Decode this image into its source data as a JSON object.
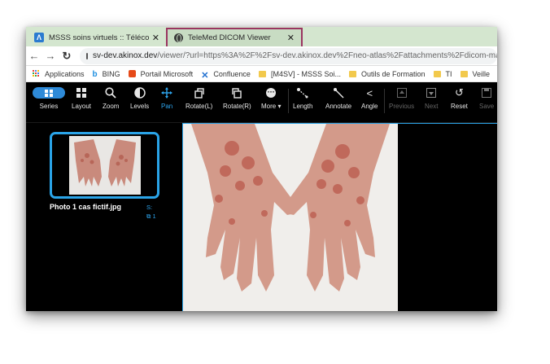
{
  "browser": {
    "tabs": [
      {
        "title": "MSSS soins virtuels :: Téléconsultati",
        "active": false
      },
      {
        "title": "TeleMed DICOM Viewer",
        "active": true
      }
    ],
    "url": {
      "host": "sv-dev.akinox.dev",
      "path": "/viewer/?url=https%3A%2F%2Fsv-dev.akinox.dev%2Fneo-atlas%2Fattachments%2Fdicom-ma"
    },
    "bookmarks": [
      {
        "label": "Applications",
        "icon": "apps-grid-icon"
      },
      {
        "label": "BING",
        "icon": "bing-icon"
      },
      {
        "label": "Portail Microsoft",
        "icon": "office-icon"
      },
      {
        "label": "Confluence",
        "icon": "confluence-icon"
      },
      {
        "label": "[M4SV] - MSSS Soi...",
        "icon": "folder-icon"
      },
      {
        "label": "Outils de Formation",
        "icon": "folder-icon"
      },
      {
        "label": "TI",
        "icon": "folder-icon"
      },
      {
        "label": "Veille",
        "icon": "folder-icon"
      }
    ]
  },
  "toolbar": {
    "series": "Series",
    "layout": "Layout",
    "zoom": "Zoom",
    "levels": "Levels",
    "pan": "Pan",
    "rotate_l": "Rotate(L)",
    "rotate_r": "Rotate(R)",
    "more": "More",
    "length": "Length",
    "annotate": "Annotate",
    "angle": "Angle",
    "previous": "Previous",
    "next": "Next",
    "reset": "Reset",
    "save": "Save"
  },
  "series_panel": {
    "name": "Photo 1 cas fictif.jpg",
    "series_number": "S:",
    "image_count": "1"
  },
  "colors": {
    "accent": "#2ea6ef",
    "tab_strip": "#d4e6cf",
    "annotation": "#9a3560"
  }
}
